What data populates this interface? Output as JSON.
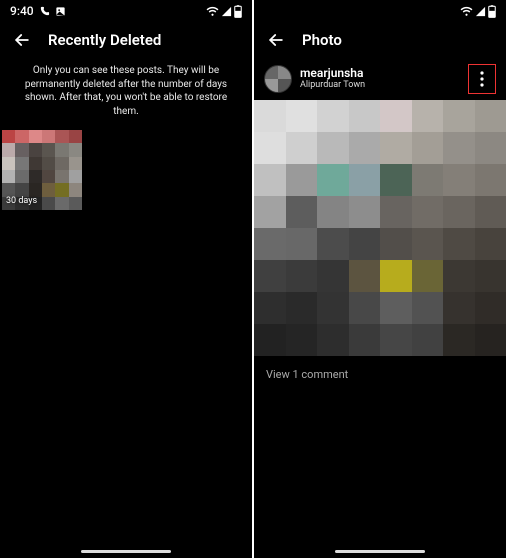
{
  "left": {
    "status": {
      "time": "9:40"
    },
    "header": {
      "title": "Recently Deleted"
    },
    "info": "Only you can see these posts. They will be permanently deleted after the number of days shown. After that, you won't be able to restore them.",
    "thumb": {
      "label": "30 days"
    }
  },
  "right": {
    "header": {
      "title": "Photo"
    },
    "user": {
      "name": "mearjunsha",
      "location": "Alipurduar Town"
    },
    "comments": {
      "label": "View 1 comment"
    }
  },
  "mosaic": {
    "thumb": [
      "#b44",
      "#c66",
      "#d88",
      "#c77",
      "#a55",
      "#944",
      "#baa",
      "#676061",
      "#4a4340",
      "#5a554f",
      "#7a7872",
      "#8a8882",
      "#c9c3bd",
      "#777",
      "#3f3834",
      "#524c46",
      "#6e6963",
      "#99948d",
      "#b2b2b2",
      "#6b6b6b",
      "#2e2a28",
      "#514640",
      "#79746e",
      "#a0a0a0",
      "#555",
      "#444",
      "#2a2623",
      "#6e5e3e",
      "#746e23",
      "#8d867e",
      "#3b3b3b",
      "#2d2d2d",
      "#232323",
      "#4a4a4a",
      "#6a6a6a",
      "#5a5a5a"
    ],
    "post": [
      "#dadada",
      "#e0e0e0",
      "#d2d2d2",
      "#c8c8c8",
      "#d3c7c7",
      "#b7b2ab",
      "#a8a49c",
      "#9e9a92",
      "#dedede",
      "#cfcfcf",
      "#b9b9b9",
      "#aaaaaa",
      "#b0aba3",
      "#a39e96",
      "#94908a",
      "#8c8882",
      "#c0c0c0",
      "#9a9a9a",
      "#6fa99a",
      "#8aa0a6",
      "#4c6456",
      "#7d7a73",
      "#847f78",
      "#7c7770",
      "#a2a2a2",
      "#5d5d5d",
      "#848484",
      "#8d8d8d",
      "#686460",
      "#716c66",
      "#6a655f",
      "#605b55",
      "#6a6a6a",
      "#686868",
      "#4c4c4c",
      "#444444",
      "#524e4a",
      "#5a554f",
      "#4f4a44",
      "#48433d",
      "#404040",
      "#3b3b3b",
      "#353535",
      "#5c5440",
      "#b7ac1d",
      "#6a6536",
      "#3c3833",
      "#38342f",
      "#2e2e2e",
      "#2a2a2a",
      "#333333",
      "#484848",
      "#5e5e5e",
      "#525252",
      "#36322e",
      "#302c28",
      "#222",
      "#252525",
      "#2d2d2d",
      "#3a3a3a",
      "#464646",
      "#414141",
      "#2b2824",
      "#262320"
    ]
  }
}
